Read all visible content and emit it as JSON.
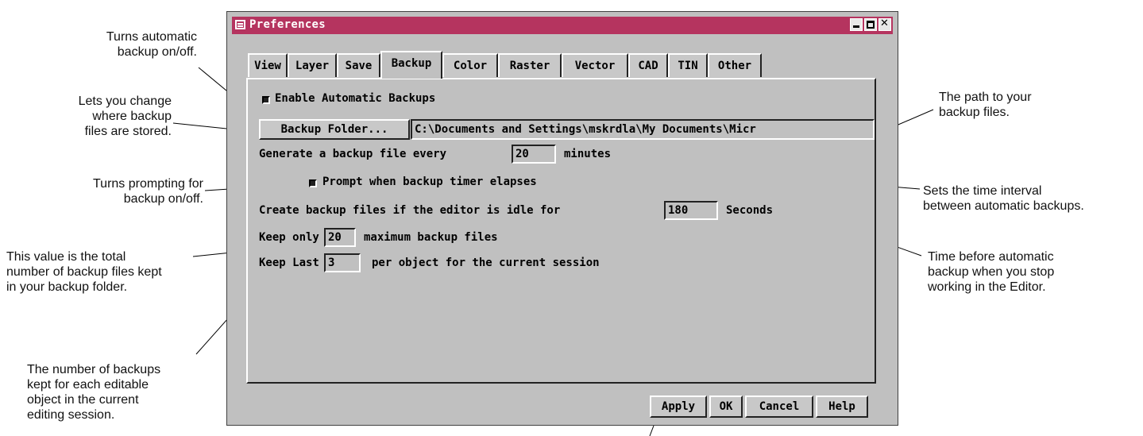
{
  "window": {
    "title": "Preferences"
  },
  "tabs": [
    {
      "label": "View"
    },
    {
      "label": "Layer"
    },
    {
      "label": "Save"
    },
    {
      "label": "Backup"
    },
    {
      "label": "Color"
    },
    {
      "label": "Raster"
    },
    {
      "label": "Vector"
    },
    {
      "label": "CAD"
    },
    {
      "label": "TIN"
    },
    {
      "label": "Other"
    }
  ],
  "active_tab": "Backup",
  "backup": {
    "enable_label": "Enable Automatic Backups",
    "enable_checked": true,
    "folder_button": "Backup Folder...",
    "folder_path": "C:\\Documents and Settings\\mskrdla\\My Documents\\Micr",
    "interval_prefix": "Generate a backup file every",
    "interval_value": "20",
    "interval_suffix": "minutes",
    "prompt_label": "Prompt when backup timer elapses",
    "prompt_checked": true,
    "idle_prefix": "Create backup files if the editor is idle for",
    "idle_value": "180",
    "idle_suffix": "Seconds",
    "keep_prefix": "Keep only",
    "keep_value": "20",
    "keep_suffix": "maximum backup files",
    "last_prefix": "Keep Last",
    "last_value": "3",
    "last_suffix": "per object for the current session"
  },
  "buttons": {
    "apply": "Apply",
    "ok": "OK",
    "cancel": "Cancel",
    "help": "Help"
  },
  "annotations": {
    "enable": [
      "Turns automatic",
      "backup on/off."
    ],
    "folder": [
      "Lets you change",
      "where backup",
      "files are stored."
    ],
    "prompt": [
      "Turns prompting for",
      "backup on/off."
    ],
    "keep": [
      "This value is the total",
      "number of backup files kept",
      "in your backup folder."
    ],
    "last": [
      "The number of backups",
      "kept for each editable",
      "object in the current",
      "editing session."
    ],
    "path": [
      "The path to your",
      "backup files."
    ],
    "interval": [
      "Sets the time interval",
      "between automatic backups."
    ],
    "idle": [
      "Time before automatic",
      "backup when you stop",
      "working in the Editor."
    ]
  },
  "colors": {
    "titlebar": "#b5345f",
    "dialog": "#c0c0c0"
  }
}
